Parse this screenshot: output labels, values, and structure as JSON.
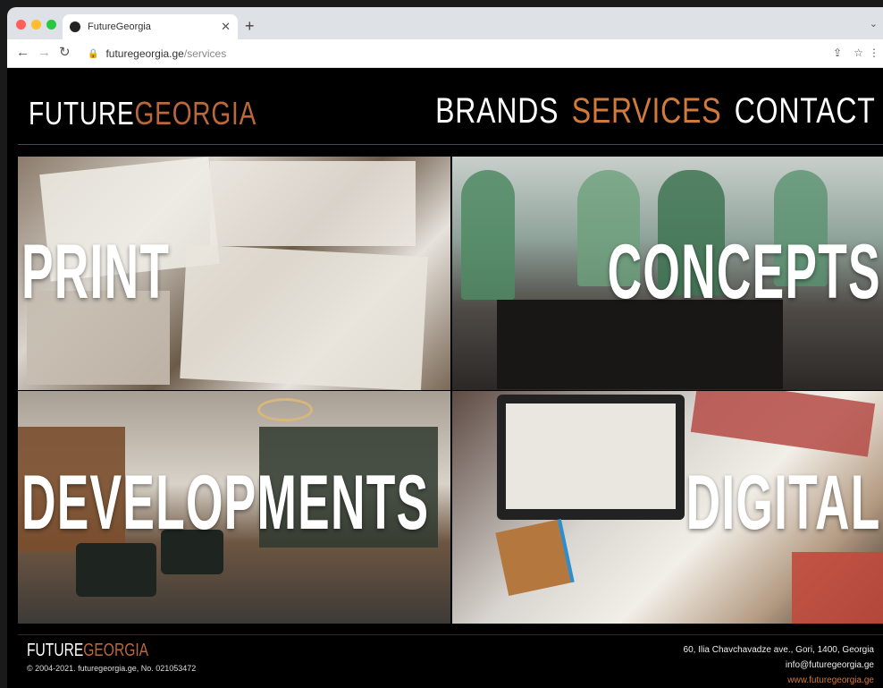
{
  "browser": {
    "tab_title": "FutureGeorgia",
    "new_tab": "+",
    "url_host": "futuregeorgia.ge",
    "url_path": "/services"
  },
  "header": {
    "logo_part1": "FUTURE",
    "logo_part2": "GEORGIA",
    "nav": [
      {
        "label": "BRANDS",
        "active": false
      },
      {
        "label": "SERVICES",
        "active": true
      },
      {
        "label": "CONTACT",
        "active": false
      }
    ]
  },
  "services": [
    {
      "label": "PRINT"
    },
    {
      "label": "CONCEPTS"
    },
    {
      "label": "DEVELOPMENTS"
    },
    {
      "label": "DIGITAL"
    }
  ],
  "footer": {
    "logo_part1": "FUTURE",
    "logo_part2": "GEORGIA",
    "copyright": "© 2004-2021. futuregeorgia.ge, No. 021053472",
    "address": "60, Ilia Chavchavadze ave., Gori, 1400, Georgia",
    "email": "info@futuregeorgia.ge",
    "website": "www.futuregeorgia.ge"
  },
  "colors": {
    "accent": "#d27a3a",
    "background": "#000000"
  }
}
